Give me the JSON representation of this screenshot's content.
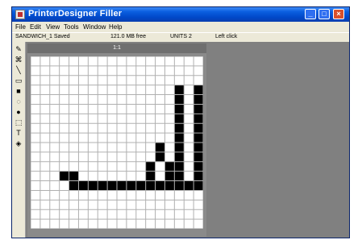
{
  "window": {
    "title": "PrinterDesigner Filler"
  },
  "titlebar_buttons": {
    "minimize": "_",
    "maximize": "□",
    "close": "×"
  },
  "menu": {
    "items": [
      "File",
      "Edit",
      "View",
      "Tools",
      "Window",
      "Help"
    ]
  },
  "infobar": {
    "items": [
      "SANDWICH_1 Saved",
      "121.0 MB free",
      "UNITS 2",
      "Left click"
    ]
  },
  "toolbar": {
    "tools": [
      {
        "name": "pencil-tool",
        "glyph": "✎"
      },
      {
        "name": "brush-tool",
        "glyph": "⌘"
      },
      {
        "name": "line-tool",
        "glyph": "╲"
      },
      {
        "name": "rect-outline-tool",
        "glyph": "▭"
      },
      {
        "name": "rect-fill-tool",
        "glyph": "■"
      },
      {
        "name": "ellipse-outline-tool",
        "glyph": "◌"
      },
      {
        "name": "ellipse-fill-tool",
        "glyph": "●"
      },
      {
        "name": "select-tool",
        "glyph": "⬚"
      },
      {
        "name": "text-tool",
        "glyph": "T"
      },
      {
        "name": "fill-tool",
        "glyph": "◈"
      }
    ]
  },
  "editor": {
    "header": "1:1",
    "grid_cols": 18,
    "grid_rows": 18,
    "filled_cells": [
      [
        3,
        12
      ],
      [
        4,
        12
      ],
      [
        4,
        13
      ],
      [
        5,
        13
      ],
      [
        6,
        13
      ],
      [
        7,
        13
      ],
      [
        8,
        13
      ],
      [
        9,
        13
      ],
      [
        10,
        13
      ],
      [
        11,
        13
      ],
      [
        12,
        13
      ],
      [
        13,
        13
      ],
      [
        14,
        13
      ],
      [
        15,
        13
      ],
      [
        16,
        13
      ],
      [
        12,
        11
      ],
      [
        13,
        10
      ],
      [
        14,
        11
      ],
      [
        14,
        12
      ],
      [
        12,
        12
      ],
      [
        13,
        9
      ],
      [
        15,
        3
      ],
      [
        15,
        4
      ],
      [
        15,
        5
      ],
      [
        15,
        6
      ],
      [
        15,
        7
      ],
      [
        15,
        8
      ],
      [
        15,
        9
      ],
      [
        15,
        10
      ],
      [
        15,
        11
      ],
      [
        15,
        12
      ],
      [
        15,
        13
      ],
      [
        17,
        3
      ],
      [
        17,
        4
      ],
      [
        17,
        5
      ],
      [
        17,
        6
      ],
      [
        17,
        7
      ],
      [
        17,
        8
      ],
      [
        17,
        9
      ],
      [
        17,
        10
      ],
      [
        17,
        11
      ],
      [
        17,
        12
      ],
      [
        17,
        13
      ]
    ]
  },
  "colors": {
    "grid_bg": "#ffffff",
    "grid_line": "#b0b0b0",
    "cell_fill": "#000000"
  }
}
